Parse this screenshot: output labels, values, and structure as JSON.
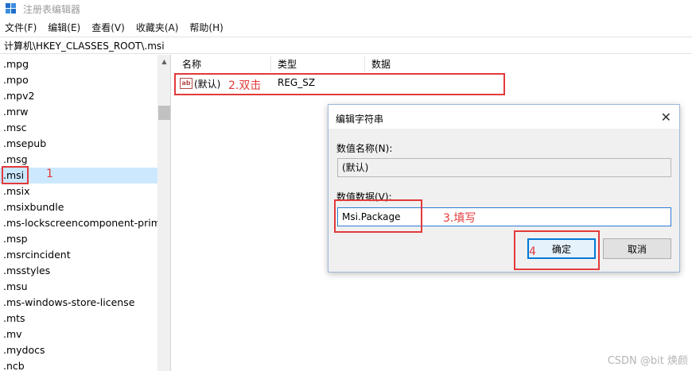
{
  "window": {
    "title": "注册表编辑器"
  },
  "menu": [
    {
      "label": "文件(F)"
    },
    {
      "label": "编辑(E)"
    },
    {
      "label": "查看(V)"
    },
    {
      "label": "收藏夹(A)"
    },
    {
      "label": "帮助(H)"
    }
  ],
  "address": "计算机\\HKEY_CLASSES_ROOT\\.msi",
  "tree": {
    "items": [
      ".mpg",
      ".mpo",
      ".mpv2",
      ".mrw",
      ".msc",
      ".msepub",
      ".msg",
      ".msi",
      ".msix",
      ".msixbundle",
      ".ms-lockscreencomponent-prima",
      ".msp",
      ".msrcincident",
      ".msstyles",
      ".msu",
      ".ms-windows-store-license",
      ".mts",
      ".mv",
      ".mydocs",
      ".ncb"
    ],
    "selected_index": 7
  },
  "list": {
    "headers": {
      "name": "名称",
      "type": "类型",
      "data": "数据"
    },
    "rows": [
      {
        "icon": "ab",
        "name": "(默认)",
        "type": "REG_SZ",
        "data": ""
      }
    ]
  },
  "dialog": {
    "title": "编辑字符串",
    "close_glyph": "✕",
    "value_name_label": "数值名称(N):",
    "value_name": "(默认)",
    "value_data_label": "数值数据(V):",
    "value_data": "Msi.Package",
    "ok_label": "确定",
    "cancel_label": "取消"
  },
  "annotations": {
    "step1": "1",
    "step2": "2.双击",
    "step3": "3.填写",
    "step4": "4"
  },
  "watermark": "CSDN @bit 焕颜",
  "colors": {
    "annotation": "#e23a3a",
    "selection": "#cce8ff",
    "focus": "#0078d7"
  }
}
